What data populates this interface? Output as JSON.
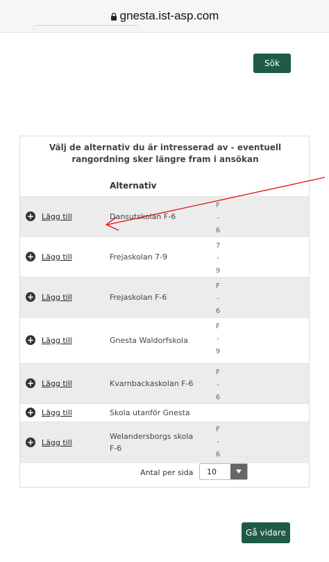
{
  "browser": {
    "url": "gnesta.ist-asp.com"
  },
  "search": {
    "button_label": "Sök"
  },
  "table": {
    "caption": "Välj de alternativ du är intresserad av - eventuell rangordning sker längre fram i ansökan",
    "column_header": "Alternativ",
    "add_label": "Lägg till",
    "rows": [
      {
        "name": "Dansutskolan F-6",
        "grade": [
          "F",
          "-",
          "6"
        ]
      },
      {
        "name": "Frejaskolan 7-9",
        "grade": [
          "7",
          "-",
          "9"
        ]
      },
      {
        "name": "Frejaskolan F-6",
        "grade": [
          "F",
          "-",
          "6"
        ]
      },
      {
        "name": "Gnesta Waldorfskola",
        "grade": [
          "F",
          "-",
          "9"
        ]
      },
      {
        "name": "Kvarnbackaskolan F-6",
        "grade": [
          "F",
          "-",
          "6"
        ]
      },
      {
        "name": "Skola utanför Gnesta",
        "grade": []
      },
      {
        "name": "Welandersborgs skola F-6",
        "grade": [
          "F",
          "-",
          "6"
        ]
      }
    ]
  },
  "pagination": {
    "per_page_label": "Antal per sida",
    "per_page_value": "10"
  },
  "next": {
    "button_label": "Gå vidare"
  },
  "colors": {
    "accent": "#1e5a45",
    "annotation_arrow": "#e01010"
  }
}
